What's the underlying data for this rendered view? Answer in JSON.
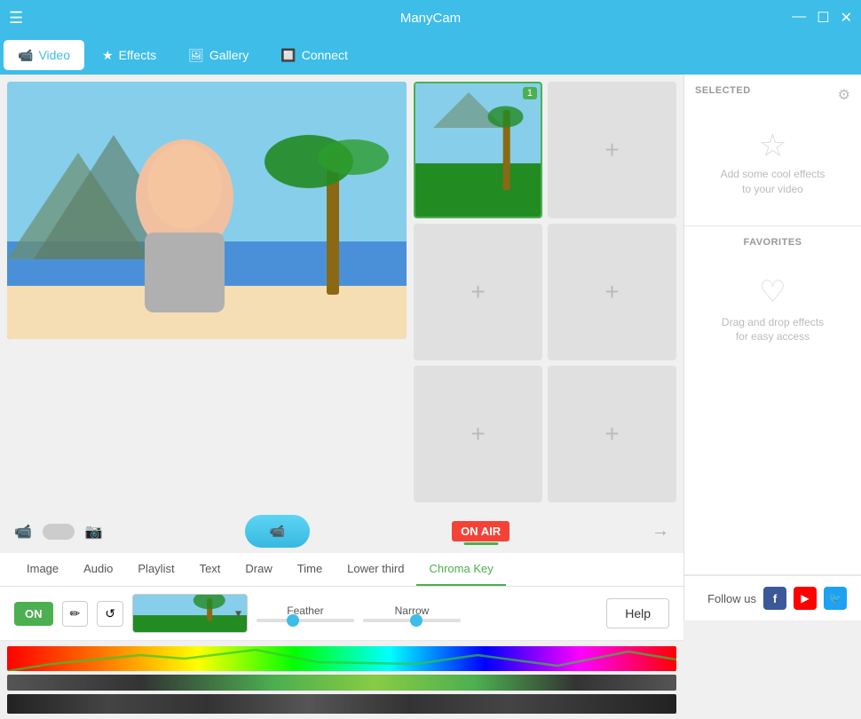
{
  "app": {
    "title": "ManyCam"
  },
  "titlebar": {
    "menu_icon": "☰",
    "minimize_icon": "—",
    "maximize_icon": "☐",
    "close_icon": "✕"
  },
  "tabs": [
    {
      "id": "video",
      "label": "Video",
      "icon": "📹",
      "active": true
    },
    {
      "id": "effects",
      "label": "Effects",
      "icon": "★"
    },
    {
      "id": "gallery",
      "label": "Gallery",
      "icon": "🖼"
    },
    {
      "id": "connect",
      "label": "Connect",
      "icon": "🔲"
    }
  ],
  "controls": {
    "cam_icon": "📹",
    "photo_icon": "📷",
    "record_label": "📹",
    "on_air_label": "ON AIR",
    "arrow": "→"
  },
  "effects_tabs": [
    {
      "id": "image",
      "label": "Image",
      "active": false
    },
    {
      "id": "audio",
      "label": "Audio",
      "active": false
    },
    {
      "id": "playlist",
      "label": "Playlist",
      "active": false
    },
    {
      "id": "text",
      "label": "Text",
      "active": false
    },
    {
      "id": "draw",
      "label": "Draw",
      "active": false
    },
    {
      "id": "time",
      "label": "Time",
      "active": false
    },
    {
      "id": "lower_third",
      "label": "Lower third",
      "active": false
    },
    {
      "id": "chroma_key",
      "label": "Chroma Key",
      "active": true
    }
  ],
  "chroma_controls": {
    "on_label": "ON",
    "eyedropper_icon": "💧",
    "reset_icon": "↺",
    "feather_label": "Feather",
    "narrow_label": "Narrow",
    "feather_value": 35,
    "narrow_value": 55,
    "help_label": "Help"
  },
  "grid": {
    "cell1_number": "1",
    "cell1_active": true
  },
  "right_panel": {
    "selected_title": "SELECTED",
    "selected_desc_line1": "Add some cool effects",
    "selected_desc_line2": "to your video",
    "favorites_title": "FAVORITES",
    "favorites_desc_line1": "Drag and drop effects",
    "favorites_desc_line2": "for easy access",
    "follow_label": "Follow us"
  },
  "social": [
    {
      "id": "facebook",
      "icon": "f",
      "class": "social-fb"
    },
    {
      "id": "youtube",
      "icon": "▶",
      "class": "social-yt"
    },
    {
      "id": "twitter",
      "icon": "🐦",
      "class": "social-tw"
    }
  ]
}
